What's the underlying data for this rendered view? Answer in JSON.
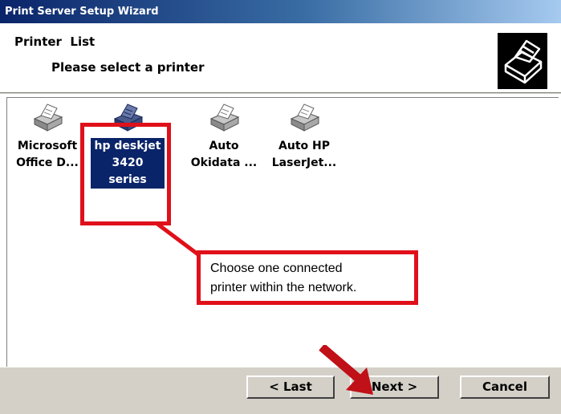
{
  "window": {
    "title": "Print Server Setup Wizard"
  },
  "header": {
    "title": "Printer  List",
    "subtitle": "Please select a printer",
    "icon": "printer-wizard-icon"
  },
  "printers": [
    {
      "label": "Microsoft\nOffice D...",
      "icon": "printer-icon",
      "selected": false
    },
    {
      "label": "hp deskjet\n3420\nseries",
      "icon": "printer-icon",
      "selected": true
    },
    {
      "label": "Auto\nOkidata ...",
      "icon": "printer-icon",
      "selected": false
    },
    {
      "label": "Auto HP\nLaserJet...",
      "icon": "printer-icon",
      "selected": false
    }
  ],
  "callout": {
    "line1": "Choose one connected",
    "line2": "printer within the network."
  },
  "buttons": {
    "last": "< Last",
    "next": "Next >",
    "cancel": "Cancel"
  },
  "colors": {
    "titlebar": "#0a246a",
    "selection": "#0a246a",
    "highlight": "#e0101a",
    "face": "#d4d0c8"
  }
}
